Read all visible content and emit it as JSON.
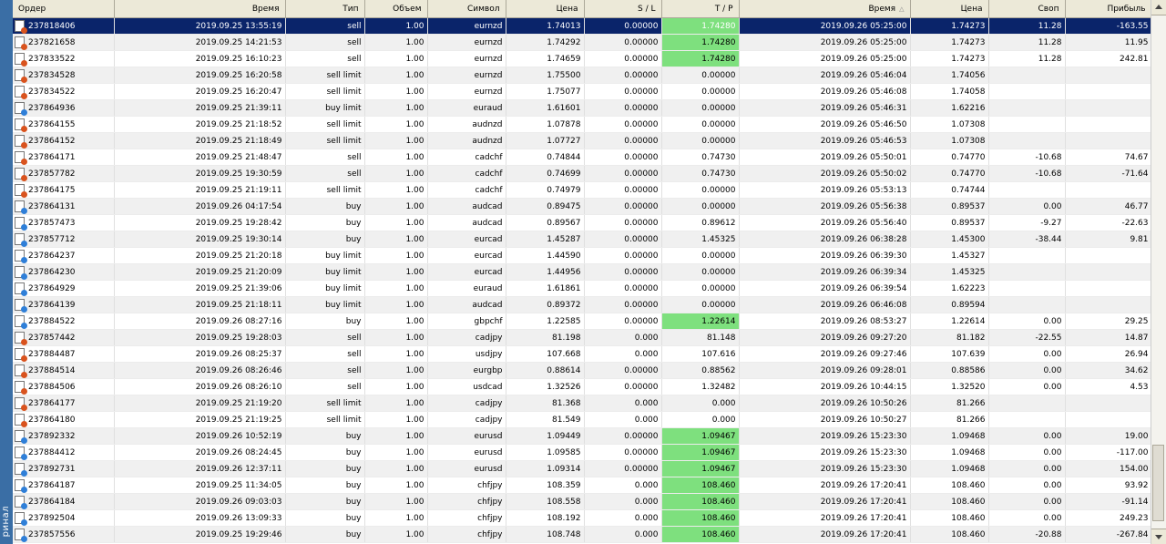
{
  "sidebar": {
    "tab_label": "ринал"
  },
  "columns": [
    "Ордер",
    "Время",
    "Тип",
    "Объем",
    "Символ",
    "Цена",
    "S / L",
    "T / P",
    "Время",
    "Цена",
    "Своп",
    "Прибыль"
  ],
  "colors": {
    "selected_row": "#0a246a",
    "tp_hit": "#7ee07e",
    "sell_icon": "#d9531e",
    "buy_icon": "#2f7fd8"
  },
  "rows": [
    {
      "order": "237818406",
      "time": "2019.09.25 13:55:19",
      "type": "sell",
      "volume": "1.00",
      "symbol": "eurnzd",
      "price": "1.74013",
      "sl": "0.00000",
      "tp": "1.74280",
      "close_time": "2019.09.26 05:25:00",
      "close_price": "1.74273",
      "swap": "11.28",
      "profit": "-163.55",
      "selected": true,
      "tp_hit": true
    },
    {
      "order": "237821658",
      "time": "2019.09.25 14:21:53",
      "type": "sell",
      "volume": "1.00",
      "symbol": "eurnzd",
      "price": "1.74292",
      "sl": "0.00000",
      "tp": "1.74280",
      "close_time": "2019.09.26 05:25:00",
      "close_price": "1.74273",
      "swap": "11.28",
      "profit": "11.95",
      "tp_hit": true
    },
    {
      "order": "237833522",
      "time": "2019.09.25 16:10:23",
      "type": "sell",
      "volume": "1.00",
      "symbol": "eurnzd",
      "price": "1.74659",
      "sl": "0.00000",
      "tp": "1.74280",
      "close_time": "2019.09.26 05:25:00",
      "close_price": "1.74273",
      "swap": "11.28",
      "profit": "242.81",
      "tp_hit": true
    },
    {
      "order": "237834528",
      "time": "2019.09.25 16:20:58",
      "type": "sell limit",
      "volume": "1.00",
      "symbol": "eurnzd",
      "price": "1.75500",
      "sl": "0.00000",
      "tp": "0.00000",
      "close_time": "2019.09.26 05:46:04",
      "close_price": "1.74056",
      "swap": "",
      "profit": ""
    },
    {
      "order": "237834522",
      "time": "2019.09.25 16:20:47",
      "type": "sell limit",
      "volume": "1.00",
      "symbol": "eurnzd",
      "price": "1.75077",
      "sl": "0.00000",
      "tp": "0.00000",
      "close_time": "2019.09.26 05:46:08",
      "close_price": "1.74058",
      "swap": "",
      "profit": ""
    },
    {
      "order": "237864936",
      "time": "2019.09.25 21:39:11",
      "type": "buy limit",
      "volume": "1.00",
      "symbol": "euraud",
      "price": "1.61601",
      "sl": "0.00000",
      "tp": "0.00000",
      "close_time": "2019.09.26 05:46:31",
      "close_price": "1.62216",
      "swap": "",
      "profit": ""
    },
    {
      "order": "237864155",
      "time": "2019.09.25 21:18:52",
      "type": "sell limit",
      "volume": "1.00",
      "symbol": "audnzd",
      "price": "1.07878",
      "sl": "0.00000",
      "tp": "0.00000",
      "close_time": "2019.09.26 05:46:50",
      "close_price": "1.07308",
      "swap": "",
      "profit": ""
    },
    {
      "order": "237864152",
      "time": "2019.09.25 21:18:49",
      "type": "sell limit",
      "volume": "1.00",
      "symbol": "audnzd",
      "price": "1.07727",
      "sl": "0.00000",
      "tp": "0.00000",
      "close_time": "2019.09.26 05:46:53",
      "close_price": "1.07308",
      "swap": "",
      "profit": ""
    },
    {
      "order": "237864171",
      "time": "2019.09.25 21:48:47",
      "type": "sell",
      "volume": "1.00",
      "symbol": "cadchf",
      "price": "0.74844",
      "sl": "0.00000",
      "tp": "0.74730",
      "close_time": "2019.09.26 05:50:01",
      "close_price": "0.74770",
      "swap": "-10.68",
      "profit": "74.67"
    },
    {
      "order": "237857782",
      "time": "2019.09.25 19:30:59",
      "type": "sell",
      "volume": "1.00",
      "symbol": "cadchf",
      "price": "0.74699",
      "sl": "0.00000",
      "tp": "0.74730",
      "close_time": "2019.09.26 05:50:02",
      "close_price": "0.74770",
      "swap": "-10.68",
      "profit": "-71.64"
    },
    {
      "order": "237864175",
      "time": "2019.09.25 21:19:11",
      "type": "sell limit",
      "volume": "1.00",
      "symbol": "cadchf",
      "price": "0.74979",
      "sl": "0.00000",
      "tp": "0.00000",
      "close_time": "2019.09.26 05:53:13",
      "close_price": "0.74744",
      "swap": "",
      "profit": ""
    },
    {
      "order": "237864131",
      "time": "2019.09.26 04:17:54",
      "type": "buy",
      "volume": "1.00",
      "symbol": "audcad",
      "price": "0.89475",
      "sl": "0.00000",
      "tp": "0.00000",
      "close_time": "2019.09.26 05:56:38",
      "close_price": "0.89537",
      "swap": "0.00",
      "profit": "46.77"
    },
    {
      "order": "237857473",
      "time": "2019.09.25 19:28:42",
      "type": "buy",
      "volume": "1.00",
      "symbol": "audcad",
      "price": "0.89567",
      "sl": "0.00000",
      "tp": "0.89612",
      "close_time": "2019.09.26 05:56:40",
      "close_price": "0.89537",
      "swap": "-9.27",
      "profit": "-22.63"
    },
    {
      "order": "237857712",
      "time": "2019.09.25 19:30:14",
      "type": "buy",
      "volume": "1.00",
      "symbol": "eurcad",
      "price": "1.45287",
      "sl": "0.00000",
      "tp": "1.45325",
      "close_time": "2019.09.26 06:38:28",
      "close_price": "1.45300",
      "swap": "-38.44",
      "profit": "9.81"
    },
    {
      "order": "237864237",
      "time": "2019.09.25 21:20:18",
      "type": "buy limit",
      "volume": "1.00",
      "symbol": "eurcad",
      "price": "1.44590",
      "sl": "0.00000",
      "tp": "0.00000",
      "close_time": "2019.09.26 06:39:30",
      "close_price": "1.45327",
      "swap": "",
      "profit": ""
    },
    {
      "order": "237864230",
      "time": "2019.09.25 21:20:09",
      "type": "buy limit",
      "volume": "1.00",
      "symbol": "eurcad",
      "price": "1.44956",
      "sl": "0.00000",
      "tp": "0.00000",
      "close_time": "2019.09.26 06:39:34",
      "close_price": "1.45325",
      "swap": "",
      "profit": ""
    },
    {
      "order": "237864929",
      "time": "2019.09.25 21:39:06",
      "type": "buy limit",
      "volume": "1.00",
      "symbol": "euraud",
      "price": "1.61861",
      "sl": "0.00000",
      "tp": "0.00000",
      "close_time": "2019.09.26 06:39:54",
      "close_price": "1.62223",
      "swap": "",
      "profit": ""
    },
    {
      "order": "237864139",
      "time": "2019.09.25 21:18:11",
      "type": "buy limit",
      "volume": "1.00",
      "symbol": "audcad",
      "price": "0.89372",
      "sl": "0.00000",
      "tp": "0.00000",
      "close_time": "2019.09.26 06:46:08",
      "close_price": "0.89594",
      "swap": "",
      "profit": ""
    },
    {
      "order": "237884522",
      "time": "2019.09.26 08:27:16",
      "type": "buy",
      "volume": "1.00",
      "symbol": "gbpchf",
      "price": "1.22585",
      "sl": "0.00000",
      "tp": "1.22614",
      "close_time": "2019.09.26 08:53:27",
      "close_price": "1.22614",
      "swap": "0.00",
      "profit": "29.25",
      "tp_hit": true
    },
    {
      "order": "237857442",
      "time": "2019.09.25 19:28:03",
      "type": "sell",
      "volume": "1.00",
      "symbol": "cadjpy",
      "price": "81.198",
      "sl": "0.000",
      "tp": "81.148",
      "close_time": "2019.09.26 09:27:20",
      "close_price": "81.182",
      "swap": "-22.55",
      "profit": "14.87"
    },
    {
      "order": "237884487",
      "time": "2019.09.26 08:25:37",
      "type": "sell",
      "volume": "1.00",
      "symbol": "usdjpy",
      "price": "107.668",
      "sl": "0.000",
      "tp": "107.616",
      "close_time": "2019.09.26 09:27:46",
      "close_price": "107.639",
      "swap": "0.00",
      "profit": "26.94"
    },
    {
      "order": "237884514",
      "time": "2019.09.26 08:26:46",
      "type": "sell",
      "volume": "1.00",
      "symbol": "eurgbp",
      "price": "0.88614",
      "sl": "0.00000",
      "tp": "0.88562",
      "close_time": "2019.09.26 09:28:01",
      "close_price": "0.88586",
      "swap": "0.00",
      "profit": "34.62"
    },
    {
      "order": "237884506",
      "time": "2019.09.26 08:26:10",
      "type": "sell",
      "volume": "1.00",
      "symbol": "usdcad",
      "price": "1.32526",
      "sl": "0.00000",
      "tp": "1.32482",
      "close_time": "2019.09.26 10:44:15",
      "close_price": "1.32520",
      "swap": "0.00",
      "profit": "4.53"
    },
    {
      "order": "237864177",
      "time": "2019.09.25 21:19:20",
      "type": "sell limit",
      "volume": "1.00",
      "symbol": "cadjpy",
      "price": "81.368",
      "sl": "0.000",
      "tp": "0.000",
      "close_time": "2019.09.26 10:50:26",
      "close_price": "81.266",
      "swap": "",
      "profit": ""
    },
    {
      "order": "237864180",
      "time": "2019.09.25 21:19:25",
      "type": "sell limit",
      "volume": "1.00",
      "symbol": "cadjpy",
      "price": "81.549",
      "sl": "0.000",
      "tp": "0.000",
      "close_time": "2019.09.26 10:50:27",
      "close_price": "81.266",
      "swap": "",
      "profit": ""
    },
    {
      "order": "237892332",
      "time": "2019.09.26 10:52:19",
      "type": "buy",
      "volume": "1.00",
      "symbol": "eurusd",
      "price": "1.09449",
      "sl": "0.00000",
      "tp": "1.09467",
      "close_time": "2019.09.26 15:23:30",
      "close_price": "1.09468",
      "swap": "0.00",
      "profit": "19.00",
      "tp_hit": true
    },
    {
      "order": "237884412",
      "time": "2019.09.26 08:24:45",
      "type": "buy",
      "volume": "1.00",
      "symbol": "eurusd",
      "price": "1.09585",
      "sl": "0.00000",
      "tp": "1.09467",
      "close_time": "2019.09.26 15:23:30",
      "close_price": "1.09468",
      "swap": "0.00",
      "profit": "-117.00",
      "tp_hit": true
    },
    {
      "order": "237892731",
      "time": "2019.09.26 12:37:11",
      "type": "buy",
      "volume": "1.00",
      "symbol": "eurusd",
      "price": "1.09314",
      "sl": "0.00000",
      "tp": "1.09467",
      "close_time": "2019.09.26 15:23:30",
      "close_price": "1.09468",
      "swap": "0.00",
      "profit": "154.00",
      "tp_hit": true
    },
    {
      "order": "237864187",
      "time": "2019.09.25 11:34:05",
      "type": "buy",
      "volume": "1.00",
      "symbol": "chfjpy",
      "price": "108.359",
      "sl": "0.000",
      "tp": "108.460",
      "close_time": "2019.09.26 17:20:41",
      "close_price": "108.460",
      "swap": "0.00",
      "profit": "93.92",
      "tp_hit": true
    },
    {
      "order": "237864184",
      "time": "2019.09.26 09:03:03",
      "type": "buy",
      "volume": "1.00",
      "symbol": "chfjpy",
      "price": "108.558",
      "sl": "0.000",
      "tp": "108.460",
      "close_time": "2019.09.26 17:20:41",
      "close_price": "108.460",
      "swap": "0.00",
      "profit": "-91.14",
      "tp_hit": true
    },
    {
      "order": "237892504",
      "time": "2019.09.26 13:09:33",
      "type": "buy",
      "volume": "1.00",
      "symbol": "chfjpy",
      "price": "108.192",
      "sl": "0.000",
      "tp": "108.460",
      "close_time": "2019.09.26 17:20:41",
      "close_price": "108.460",
      "swap": "0.00",
      "profit": "249.23",
      "tp_hit": true
    },
    {
      "order": "237857556",
      "time": "2019.09.25 19:29:46",
      "type": "buy",
      "volume": "1.00",
      "symbol": "chfjpy",
      "price": "108.748",
      "sl": "0.000",
      "tp": "108.460",
      "close_time": "2019.09.26 17:20:41",
      "close_price": "108.460",
      "swap": "-20.88",
      "profit": "-267.84",
      "tp_hit": true
    }
  ]
}
